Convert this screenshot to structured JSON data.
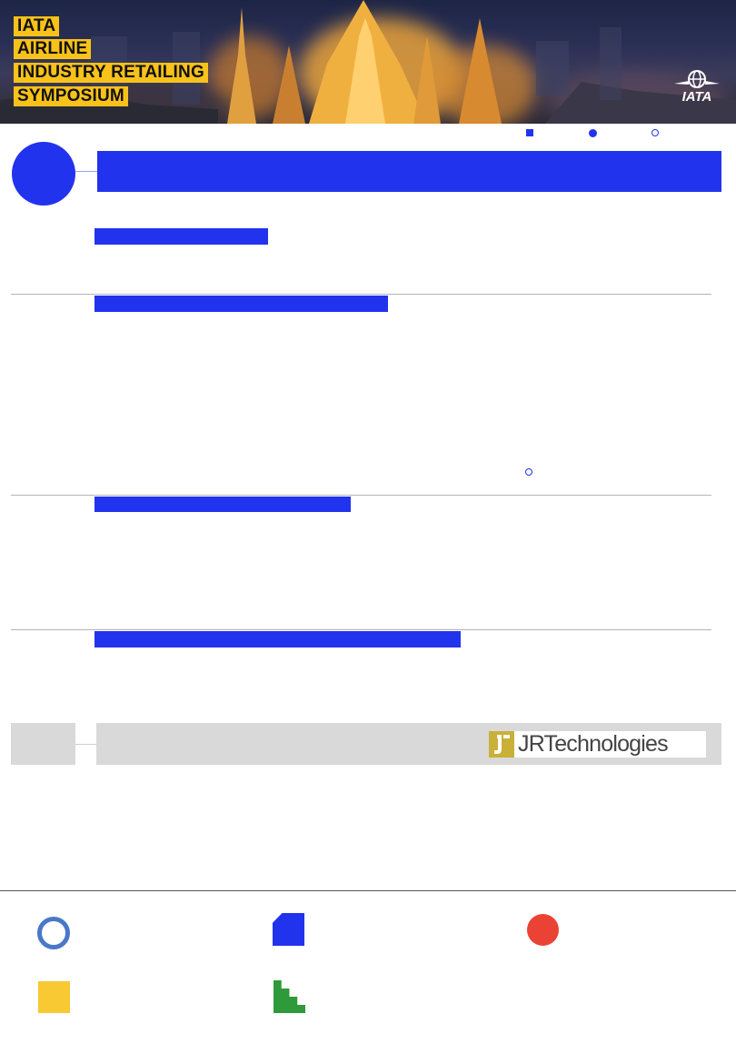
{
  "banner": {
    "title_lines": [
      "IATA",
      "AIRLINE",
      "INDUSTRY RETAILING",
      "SYMPOSIUM"
    ],
    "logo_text": "IATA"
  },
  "sponsor": {
    "logo_text": "JRTechnologies"
  },
  "colors": {
    "accent_blue": "#2233ee",
    "banner_yellow": "#f9c21a",
    "ring_blue": "#4a78c8",
    "red": "#ea4335",
    "yellow": "#f9c934",
    "green": "#2e9a3a",
    "grey": "#d9d9d9"
  },
  "legend_icons": [
    "square-icon",
    "dot-icon",
    "ring-icon"
  ],
  "footer_shapes": [
    "ring-shape-icon",
    "notched-square-icon",
    "red-dot-icon",
    "yellow-square-icon",
    "stairs-icon"
  ]
}
